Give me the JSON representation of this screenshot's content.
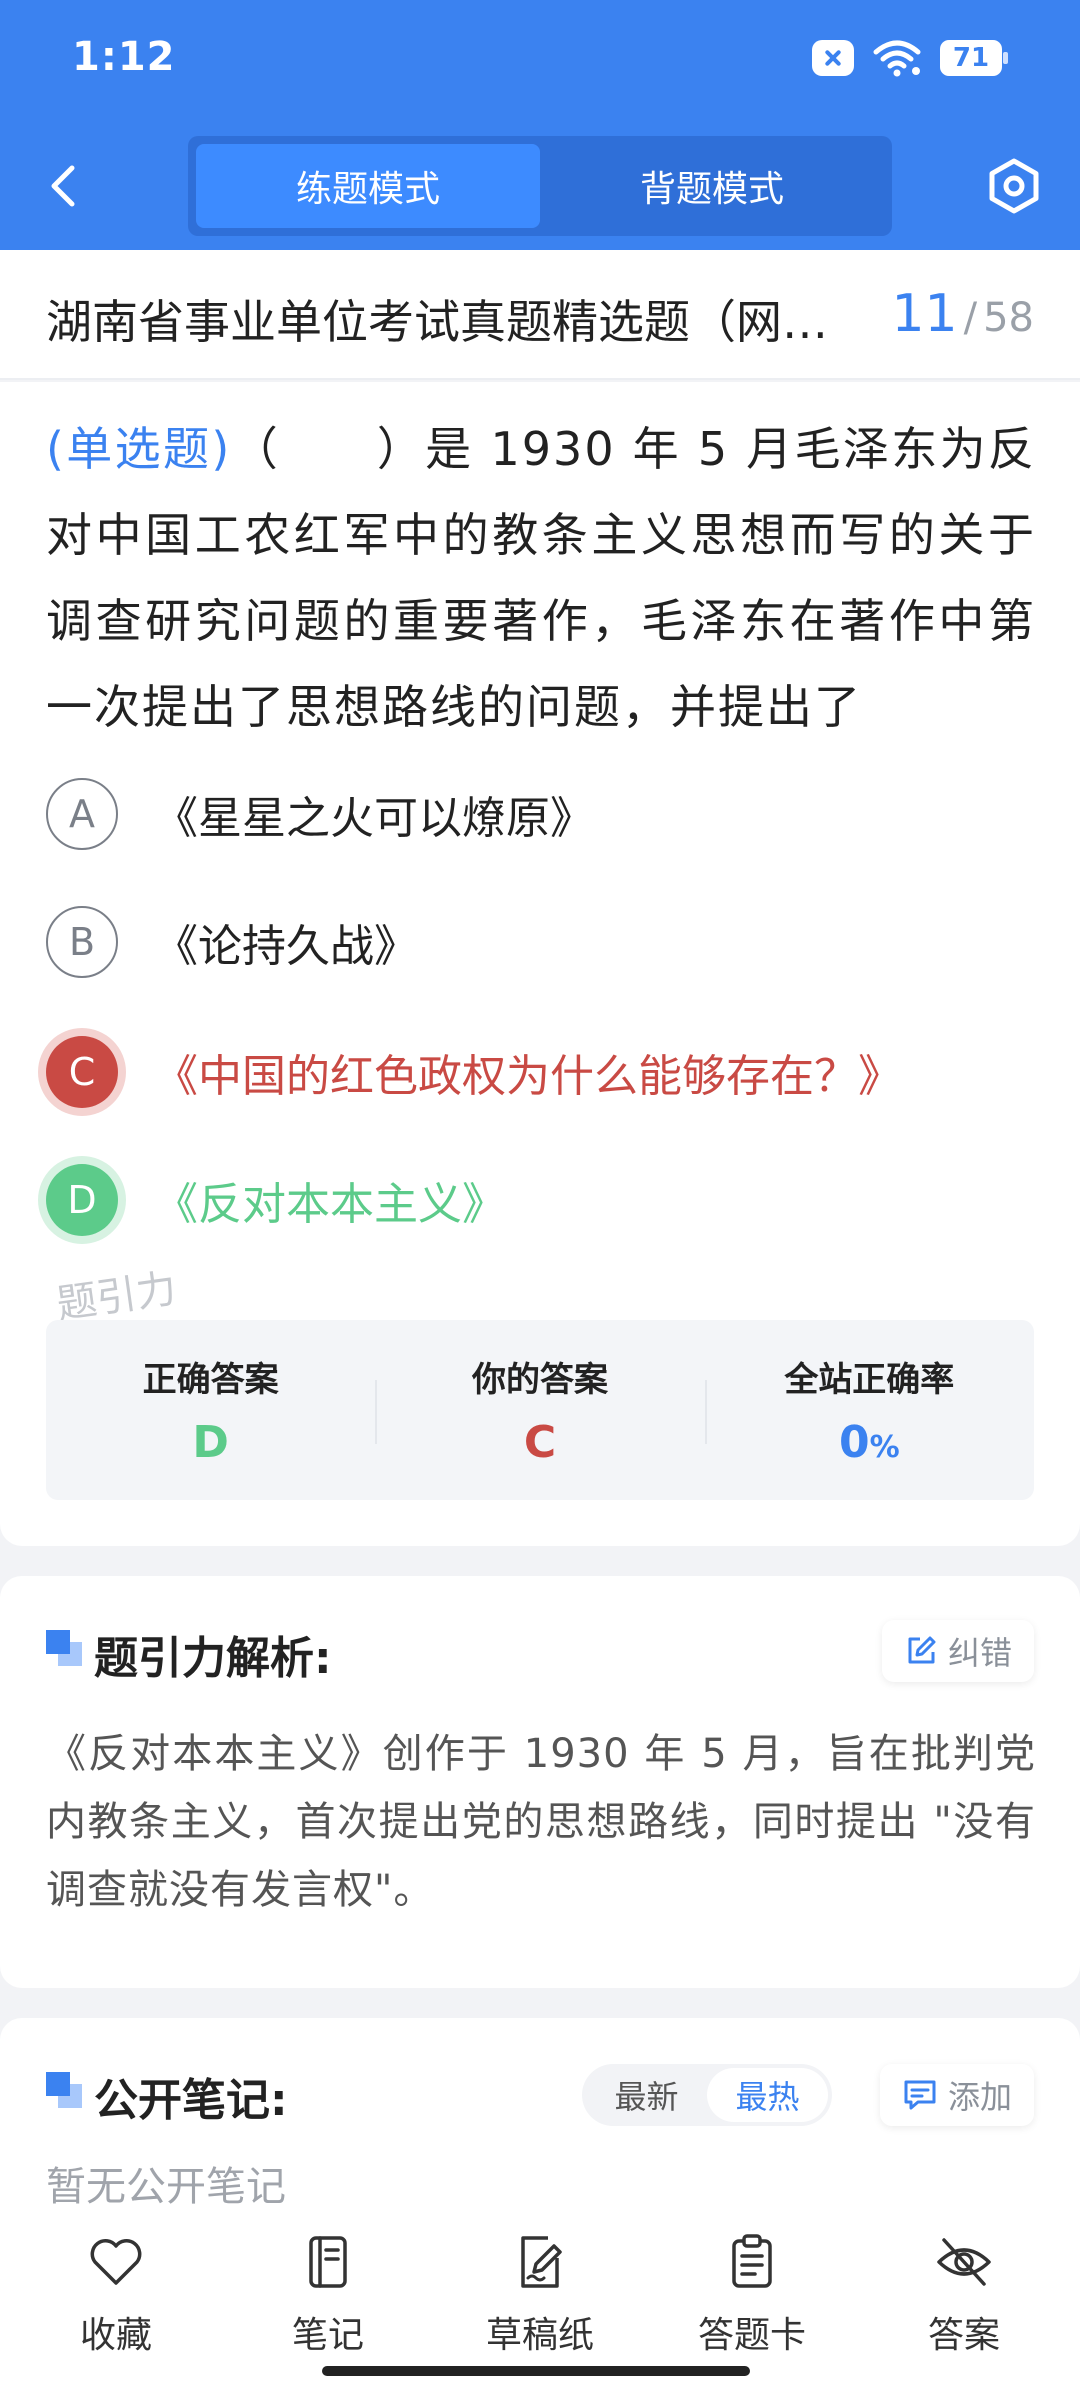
{
  "status_bar": {
    "time": "1:12",
    "battery": "71"
  },
  "nav": {
    "modes": [
      {
        "label": "练题模式",
        "active": true
      },
      {
        "label": "背题模式",
        "active": false
      }
    ]
  },
  "title_row": {
    "title": "湖南省事业单位考试真题精选题（网…",
    "current": "11",
    "separator": "/",
    "total": "58"
  },
  "question": {
    "type_label": "(单选题)",
    "stem": "（　　）是 1930 年 5 月毛泽东为反对中国工农红军中的教条主义思想而写的关于调查研究问题的重要著作，毛泽东在著作中第一次提出了思想路线的问题，并提出了",
    "options": [
      {
        "letter": "A",
        "text": "《星星之火可以燎原》",
        "state": "normal"
      },
      {
        "letter": "B",
        "text": "《论持久战》",
        "state": "normal"
      },
      {
        "letter": "C",
        "text": "《中国的红色政权为什么能够存在？》",
        "state": "wrong"
      },
      {
        "letter": "D",
        "text": "《反对本本主义》",
        "state": "correct"
      }
    ],
    "watermark": "题引力"
  },
  "result": {
    "correct_label": "正确答案",
    "correct_value": "D",
    "yours_label": "你的答案",
    "yours_value": "C",
    "rate_label": "全站正确率",
    "rate_value": "0",
    "rate_unit": "%"
  },
  "analysis": {
    "title": "题引力解析:",
    "report_label": "纠错",
    "text": "《反对本本主义》创作于 1930 年 5 月，旨在批判党内教条主义，首次提出党的思想路线，同时提出 \"没有调查就没有发言权\"。"
  },
  "notes": {
    "title": "公开笔记:",
    "sort_options": [
      {
        "label": "最新",
        "active": false
      },
      {
        "label": "最热",
        "active": true
      }
    ],
    "add_label": "添加",
    "empty_text": "暂无公开笔记"
  },
  "bottom_bar": {
    "items": [
      {
        "label": "收藏",
        "icon": "heart-icon"
      },
      {
        "label": "笔记",
        "icon": "notebook-icon"
      },
      {
        "label": "草稿纸",
        "icon": "draft-paper-icon"
      },
      {
        "label": "答题卡",
        "icon": "answer-sheet-icon"
      },
      {
        "label": "答案",
        "icon": "eye-off-icon"
      }
    ]
  },
  "colors": {
    "primary": "#3b82f0",
    "wrong": "#c94a44",
    "correct": "#5ccb8a"
  }
}
